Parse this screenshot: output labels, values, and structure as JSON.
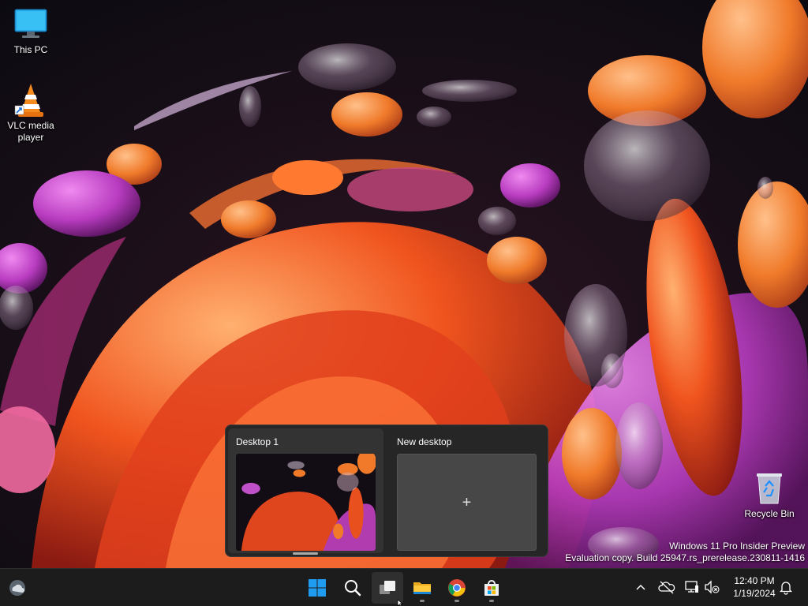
{
  "desktop": {
    "icons": [
      {
        "label": "This PC",
        "icon": "this-pc-icon"
      },
      {
        "label": "VLC media player",
        "icon": "vlc-icon"
      },
      {
        "label": "Recycle Bin",
        "icon": "recycle-bin-icon"
      }
    ],
    "watermark": {
      "line1": "Windows 11 Pro Insider Preview",
      "line2": "Evaluation copy. Build 25947.rs_prerelease.230811-1416"
    }
  },
  "task_view": {
    "desktops": [
      {
        "title": "Desktop 1",
        "selected": true
      },
      {
        "title": "New desktop",
        "plus": "+"
      }
    ]
  },
  "taskbar": {
    "pinned": [
      "start-icon",
      "search-icon",
      "task-view-icon",
      "file-explorer-icon",
      "chrome-icon",
      "microsoft-store-icon"
    ],
    "tray": {
      "icons": [
        "chevron-up-icon",
        "onedrive-offline-icon",
        "network-icon",
        "volume-muted-icon",
        "notification-bell-icon"
      ],
      "time": "12:40 PM",
      "date": "1/19/2024"
    }
  },
  "colors": {
    "taskbar": "#1c1c1c",
    "flyout": "#262626",
    "accent": "#0078d4"
  }
}
